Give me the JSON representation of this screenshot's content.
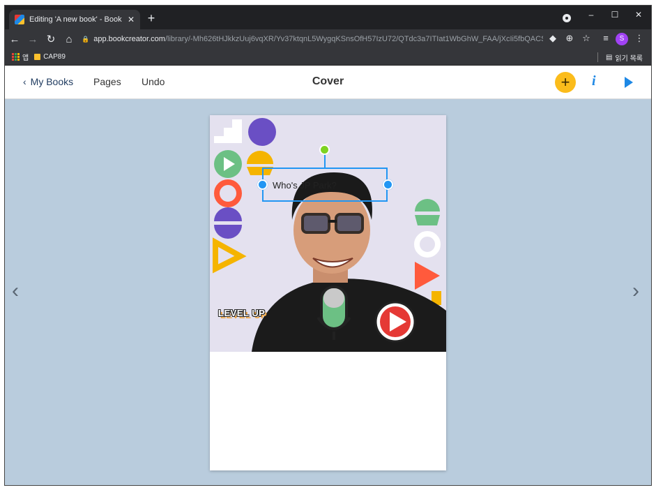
{
  "browser": {
    "tab_title": "Editing 'A new book' - Book Cr",
    "tab_close": "✕",
    "new_tab": "+",
    "window_controls": [
      "–",
      "☐",
      "✕"
    ],
    "url_domain": "app.bookcreator.com",
    "url_path": "/library/-Mh626tHJkkzUuj6vqXR/Yv37ktqnL5WygqKSnsOfH57IzU72/QTdc3a7ITIat1WbGhW_FAA/jXcIi5fbQACS...",
    "profile_initial": "S",
    "bookmarks": [
      {
        "icon": "apps-icon",
        "label": "앱"
      },
      {
        "icon": "folder-icon",
        "label": "CAP89"
      }
    ],
    "reading_list": "읽기 목록"
  },
  "app": {
    "back_label": "My Books",
    "pages_label": "Pages",
    "undo_label": "Undo",
    "title": "Cover",
    "add_symbol": "+",
    "info_symbol": "i",
    "accent_color": "#1e88e5",
    "add_color": "#fbbc1b",
    "workspace_color": "#b9ccdd"
  },
  "canvas": {
    "cover_sticker": "LEVEL UP",
    "text_box_value": "Who's JP Park?",
    "prev_arrow": "‹",
    "next_arrow": "›"
  }
}
